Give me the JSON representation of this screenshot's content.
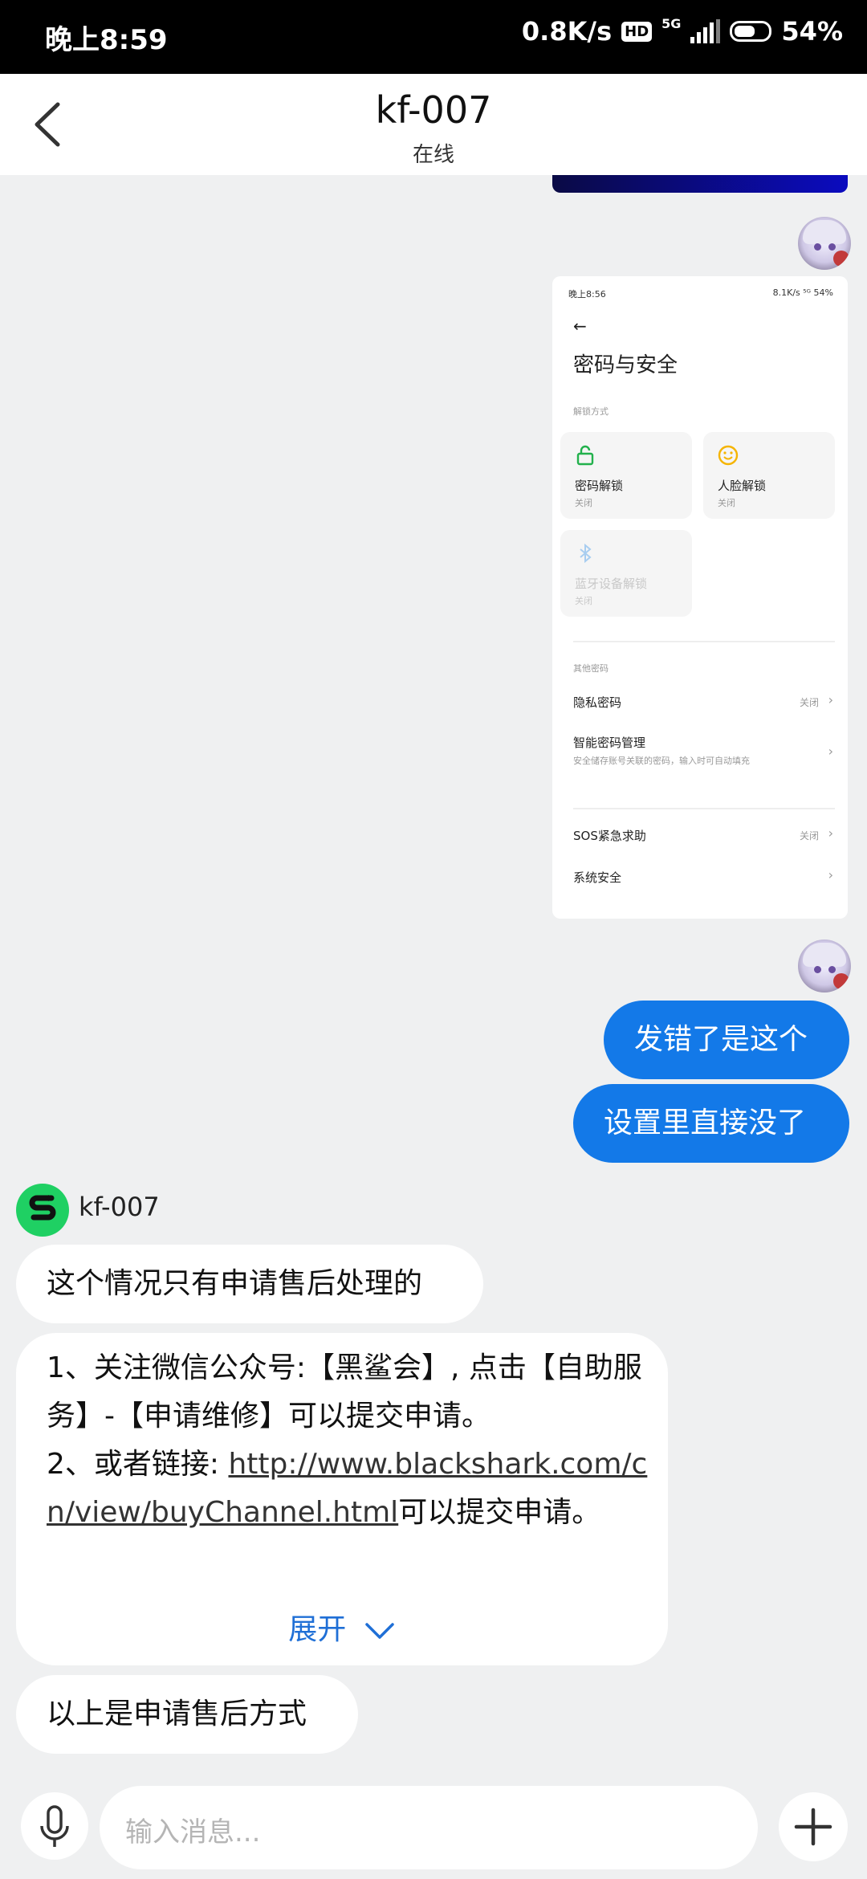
{
  "status_bar": {
    "time": "晚上8:59",
    "speed": "0.8K/s",
    "hd": "HD",
    "network": "5G",
    "battery": "54%"
  },
  "header": {
    "title": "kf-007",
    "subtitle": "在线"
  },
  "embedded_screenshot": {
    "status_time": "晚上8:56",
    "status_right": "8.1K/s ⁵ᴳ 54%",
    "back": "←",
    "title": "密码与安全",
    "section_unlock": "解锁方式",
    "cards": [
      {
        "title": "密码解锁",
        "sub": "关闭",
        "icon": "lock-icon"
      },
      {
        "title": "人脸解锁",
        "sub": "关闭",
        "icon": "face-icon"
      },
      {
        "title": "蓝牙设备解锁",
        "sub": "关闭",
        "icon": "bluetooth-icon"
      }
    ],
    "section_other": "其他密码",
    "rows": [
      {
        "title": "隐私密码",
        "value": "关闭",
        "sub": ""
      },
      {
        "title": "智能密码管理",
        "value": "",
        "sub": "安全储存账号关联的密码，输入时可自动填充"
      },
      {
        "title": "SOS紧急求助",
        "value": "关闭",
        "sub": ""
      },
      {
        "title": "系统安全",
        "value": "",
        "sub": ""
      }
    ],
    "chevron": "›"
  },
  "messages": {
    "me_1": "发错了是这个",
    "me_2": "设置里直接没了",
    "agent_name": "kf-007",
    "them_1": "这个情况只有申请售后处理的",
    "them_2_line1": "1、关注微信公众号:【黑鲨会】, 点击【自助服务】-【申请维修】可以提交申请。",
    "them_2_line2_prefix": "2、或者链接: ",
    "them_2_link": "http://www.blackshark.com/cn/view/buyChannel.html",
    "them_2_line2_suffix": "可以提交申请。",
    "expand": "展开",
    "them_3": "以上是申请售后方式"
  },
  "input": {
    "placeholder": "输入消息..."
  },
  "colors": {
    "accent": "#1379e8",
    "agent_logo": "#1fd063",
    "link_expand": "#1f6fd6"
  }
}
